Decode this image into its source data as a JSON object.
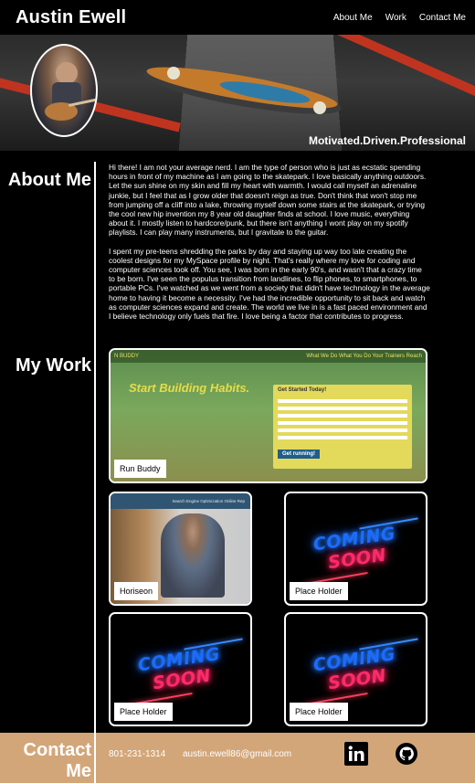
{
  "nav": {
    "brand": "Austin Ewell",
    "links": [
      "About Me",
      "Work",
      "Contact Me"
    ]
  },
  "hero": {
    "tagline": "Motivated.Driven.Professional"
  },
  "about": {
    "title": "About Me",
    "paragraphs": [
      "Hi there! I am not your average nerd. I am the type of person who is just as ecstatic spending hours in front of my machine as I am going to the skatepark. I love basically anything outdoors. Let the sun shine on my skin and fill my heart with warmth. I would call myself an adrenaline junkie, but I feel that as I grow older that doesn't reign as true. Don't think that won't stop me from jumping off a cliff into a lake, throwing myself down some stairs at the skatepark, or trying the cool new hip invention my 8 year old daughter finds at school. I love music, everything about it. I mostly listen to hardcore/punk, but there isn't anything I wont play on my spotify playlists. I can play many instruments, but I gravitate to the guitar.",
      "I spent my pre-teens shredding the parks by day and staying up way too late creating the coolest designs for my MySpace profile by night. That's really where my love for coding and computer sciences took off. You see, I was born in the early 90's, and wasn't that a crazy time to be born. I've seen the populus transition from landlines, to flip phones, to smartphones, to portable PCs. I've watched as we went from a society that didn't have technology in the average home to having it become a necessity. I've had the incredible opportunity to sit back and watch as computer sciences expand and create. The world we live in is a fast paced environment and I believe technology only fuels that fire. I love being a factor that contributes to progress."
    ]
  },
  "work": {
    "title": "My Work",
    "featured": {
      "label": "Run Buddy",
      "preview": {
        "brand": "N BUDDY",
        "nav": "What We Do   What You Do   Your Trainers   Reach",
        "headline": "Start Building Habits.",
        "form_title": "Get Started Today!",
        "form_button": "Get running!"
      }
    },
    "projects": [
      {
        "label": "Horiseon",
        "preview_nav": "Search Engine Optimization   Online Rep"
      },
      {
        "label": "Place Holder",
        "neon_top": "COMING",
        "neon_bottom": "SOON"
      },
      {
        "label": "Place Holder",
        "neon_top": "COMING",
        "neon_bottom": "SOON"
      },
      {
        "label": "Place Holder",
        "neon_top": "COMING",
        "neon_bottom": "SOON"
      }
    ]
  },
  "contact": {
    "title": "Contact Me",
    "phone": "801-231-1314",
    "email": "austin.ewell86@gmail.com",
    "icons": [
      "linkedin-icon",
      "github-icon"
    ]
  },
  "colors": {
    "background": "#000000",
    "contact_bg": "#d2a679",
    "accent_red": "#c0341f"
  }
}
